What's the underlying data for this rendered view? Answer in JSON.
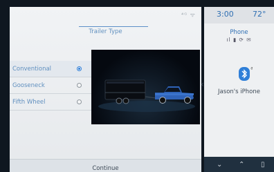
{
  "status_icons": "⁴ᴳ ᯤ",
  "left": {
    "title": "Trailer Type",
    "options": [
      {
        "label": "Conventional",
        "selected": true
      },
      {
        "label": "Gooseneck",
        "selected": false
      },
      {
        "label": "Fifth Wheel",
        "selected": false
      }
    ],
    "continue_label": "Continue"
  },
  "right": {
    "time": "3:00",
    "temp": "72°",
    "phone_title": "Phone",
    "phone_status": "ıl ▮ ⟳ ✉",
    "device_name": "Jason's iPhone"
  },
  "colors": {
    "accent": "#2f7fd8",
    "text_blue": "#5f8fbf",
    "bottom_bar": "#20303f"
  },
  "icons": [
    "wifi-icon",
    "bluetooth-icon",
    "chevron-down-icon",
    "chevron-up-icon",
    "radio-button"
  ]
}
